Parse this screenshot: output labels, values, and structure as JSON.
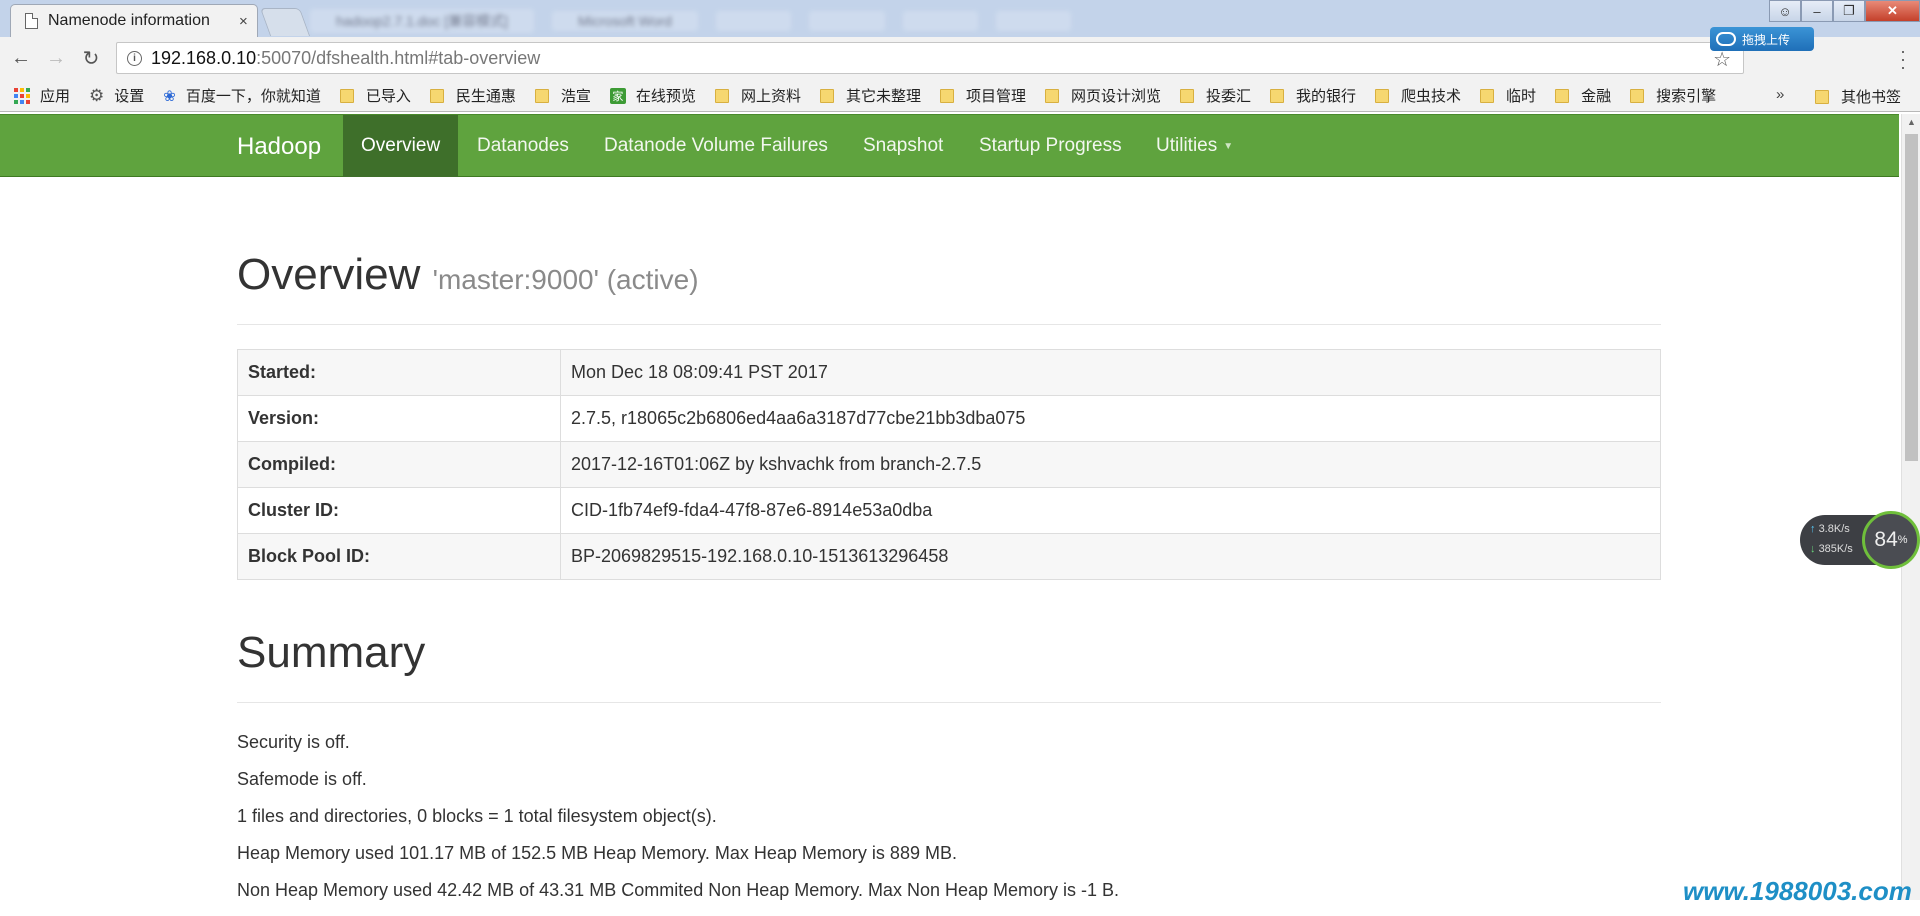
{
  "browser": {
    "tab_title": "Namenode information",
    "tab_close": "×",
    "blurred_tabs": [
      "hadoop2.7.1.doc [兼容模式]",
      "Microsoft Word",
      "",
      "",
      "",
      "",
      ""
    ],
    "upload_label": "拖拽上传",
    "url_host": "192.168.0.10",
    "url_rest": ":50070/dfshealth.html#tab-overview",
    "window_controls": [
      "user",
      "minimize",
      "restore",
      "close"
    ]
  },
  "bookmarks": {
    "items": [
      {
        "label": "应用",
        "icon": "apps-icon"
      },
      {
        "label": "设置",
        "icon": "gear-icon"
      },
      {
        "label": "百度一下，你就知道",
        "icon": "baidu-paw-icon"
      },
      {
        "label": "已导入",
        "icon": "folder-icon"
      },
      {
        "label": "民生通惠",
        "icon": "folder-icon"
      },
      {
        "label": "浩宣",
        "icon": "folder-icon"
      },
      {
        "label": "在线预览",
        "icon": "home-icon"
      },
      {
        "label": "网上资料",
        "icon": "folder-icon"
      },
      {
        "label": "其它未整理",
        "icon": "folder-icon"
      },
      {
        "label": "项目管理",
        "icon": "folder-icon"
      },
      {
        "label": "网页设计浏览",
        "icon": "folder-icon"
      },
      {
        "label": "投委汇",
        "icon": "folder-icon"
      },
      {
        "label": "我的银行",
        "icon": "folder-icon"
      },
      {
        "label": "爬虫技术",
        "icon": "folder-icon"
      },
      {
        "label": "临时",
        "icon": "folder-icon"
      },
      {
        "label": "金融",
        "icon": "folder-icon"
      },
      {
        "label": "搜索引擎",
        "icon": "folder-icon"
      }
    ],
    "more": "»",
    "other": "其他书签"
  },
  "navbar": {
    "brand": "Hadoop",
    "items": [
      "Overview",
      "Datanodes",
      "Datanode Volume Failures",
      "Snapshot",
      "Startup Progress",
      "Utilities"
    ],
    "active": "Overview"
  },
  "overview": {
    "title": "Overview",
    "subtitle": "'master:9000' (active)",
    "rows": [
      {
        "key": "Started:",
        "value": "Mon Dec 18 08:09:41 PST 2017"
      },
      {
        "key": "Version:",
        "value": "2.7.5, r18065c2b6806ed4aa6a3187d77cbe21bb3dba075"
      },
      {
        "key": "Compiled:",
        "value": "2017-12-16T01:06Z by kshvachk from branch-2.7.5"
      },
      {
        "key": "Cluster ID:",
        "value": "CID-1fb74ef9-fda4-47f8-87e6-8914e53a0dba"
      },
      {
        "key": "Block Pool ID:",
        "value": "BP-2069829515-192.168.0.10-1513613296458"
      }
    ]
  },
  "summary": {
    "title": "Summary",
    "lines": [
      "Security is off.",
      "Safemode is off.",
      "1 files and directories, 0 blocks = 1 total filesystem object(s).",
      "Heap Memory used 101.17 MB of 152.5 MB Heap Memory. Max Heap Memory is 889 MB.",
      "Non Heap Memory used 42.42 MB of 43.31 MB Commited Non Heap Memory. Max Non Heap Memory is -1 B."
    ]
  },
  "speed_widget": {
    "upload": "3.8K/s",
    "download": "385K/s",
    "percent": "84",
    "percent_suffix": "%"
  },
  "watermark": "www.1988003.com",
  "colors": {
    "navbar": "#5fa33e",
    "navbar_active": "#3e6f2a",
    "watermark": "#1e8fc6"
  }
}
